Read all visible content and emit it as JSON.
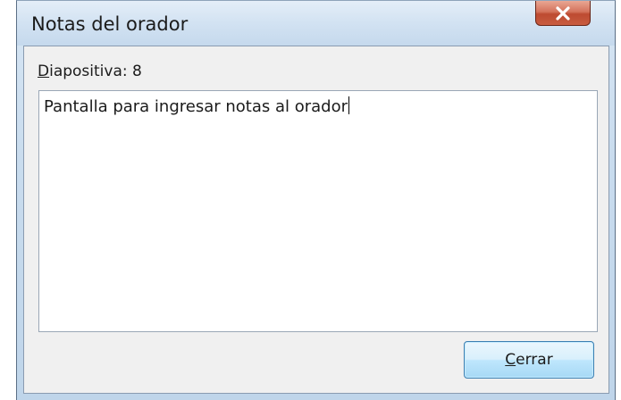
{
  "window": {
    "title": "Notas del orador"
  },
  "slide": {
    "label_mnemonic": "D",
    "label_rest": "iapositiva: 8"
  },
  "notes": {
    "text": "Pantalla para ingresar notas al orador"
  },
  "buttons": {
    "close_mnemonic": "C",
    "close_rest": "errar"
  },
  "icons": {
    "window_close": "close-icon"
  }
}
